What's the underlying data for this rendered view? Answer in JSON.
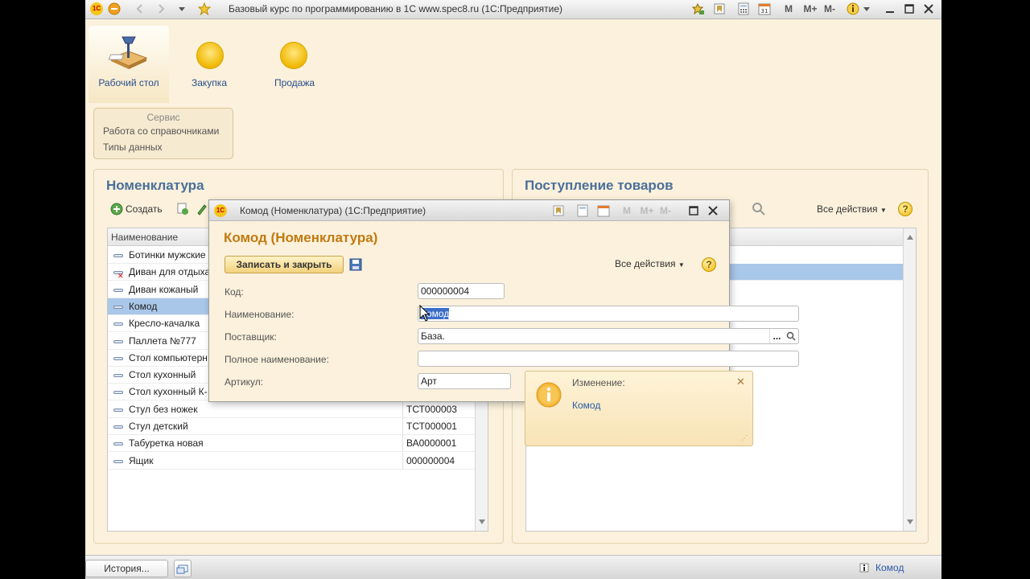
{
  "titlebar": {
    "title": "Базовый курс по программированию в 1С www.spec8.ru  (1С:Предприятие)",
    "logo": "1С",
    "buttons": {
      "m": "M",
      "mplus": "M+",
      "mminus": "M-"
    }
  },
  "sections": [
    {
      "label": "Рабочий стол",
      "icon": "desk-lamp-icon",
      "active": true
    },
    {
      "label": "Закупка",
      "icon": "yellow-circle-icon"
    },
    {
      "label": "Продажа",
      "icon": "yellow-circle-icon"
    }
  ],
  "service": {
    "header": "Сервис",
    "items": [
      "Работа со справочниками",
      "Типы данных"
    ]
  },
  "nomenclature": {
    "title": "Номенклатура",
    "create_label": "Создать",
    "column_name": "Наименование",
    "rows": [
      {
        "name": "Ботинки мужские",
        "code": "",
        "deleted": false
      },
      {
        "name": "Диван для отдыха",
        "code": "",
        "deleted": true
      },
      {
        "name": "Диван кожаный",
        "code": "",
        "deleted": false
      },
      {
        "name": "Комод",
        "code": "",
        "deleted": false,
        "selected": true
      },
      {
        "name": "Кресло-качалка",
        "code": "",
        "deleted": false
      },
      {
        "name": "Паллета №777",
        "code": "",
        "deleted": false
      },
      {
        "name": "Стол компьютерн",
        "code": "",
        "deleted": false
      },
      {
        "name": "Стол кухонный",
        "code": "",
        "deleted": false
      },
      {
        "name": "Стол кухонный К-",
        "code": "",
        "deleted": false
      },
      {
        "name": "Стул без ножек",
        "code": "ТСТ000003",
        "deleted": false
      },
      {
        "name": "Стул детский",
        "code": "ТСТ000001",
        "deleted": false
      },
      {
        "name": "Табуретка новая",
        "code": "ВА0000001",
        "deleted": false
      },
      {
        "name": "Ящик",
        "code": "000000004",
        "deleted": false
      }
    ]
  },
  "receipts": {
    "title": "Поступление товаров",
    "all_actions": "Все действия"
  },
  "dialog": {
    "window_title": "Комод (Номенклатура)  (1С:Предприятие)",
    "heading": "Комод (Номенклатура)",
    "save_close_label": "Записать и закрыть",
    "all_actions": "Все действия",
    "help": "?",
    "fields": {
      "code_label": "Код:",
      "code_value": "000000004",
      "name_label": "Наименование:",
      "name_value": "Комод",
      "supplier_label": "Поставщик:",
      "supplier_value": "База.",
      "fullname_label": "Полное наименование:",
      "fullname_value": "",
      "article_label": "Артикул:",
      "article_value": "Арт"
    },
    "choose_button": "..."
  },
  "notification": {
    "title": "Изменение:",
    "link": "Комод",
    "close": "✕"
  },
  "bottom": {
    "history_label": "История...",
    "status_text": "Комод"
  },
  "colors": {
    "background": "#fbf1dc",
    "accent_orange": "#c07a10",
    "panel_title_blue": "#4a6f9a",
    "selection": "#a9c7e8"
  }
}
